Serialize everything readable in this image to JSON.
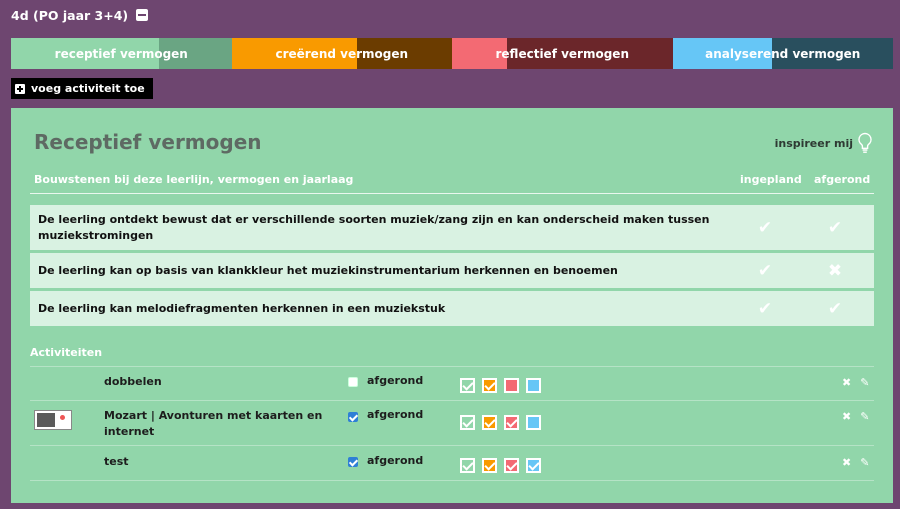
{
  "header": {
    "title": "4d (PO jaar 3+4)"
  },
  "abilities": [
    {
      "label": "receptief vermogen",
      "color": "#91d6aa",
      "rest_color": "#6aa583",
      "progress": 0.67
    },
    {
      "label": "creërend vermogen",
      "color": "#f99a00",
      "rest_color": "#6b3c00",
      "progress": 0.57
    },
    {
      "label": "reflectief vermogen",
      "color": "#f36a73",
      "rest_color": "#6b262a",
      "progress": 0.25
    },
    {
      "label": "analyserend vermogen",
      "color": "#66c6f6",
      "rest_color": "#294f5e",
      "progress": 0.45
    }
  ],
  "toolbar": {
    "add_activity": "voeg activiteit toe"
  },
  "panel": {
    "title": "Receptief vermogen",
    "inspire": "inspireer mij",
    "section_heading": "Bouwstenen bij deze leerlijn, vermogen en jaarlaag",
    "col_planned": "ingepland",
    "col_done": "afgerond",
    "building_blocks": [
      {
        "text": "De leerling ontdekt bewust dat er verschillende soorten muziek/zang zijn en kan onderscheid maken tussen muziekstromingen",
        "planned": "✔",
        "done": "✔"
      },
      {
        "text": "De leerling kan op basis van klankkleur het muziekinstrumentarium herkennen en benoemen",
        "planned": "✔",
        "done": "✖"
      },
      {
        "text": "De leerling kan melodiefragmenten herkennen in een muziekstuk",
        "planned": "✔",
        "done": "✔"
      }
    ],
    "activities_heading": "Activiteiten",
    "activities": [
      {
        "name": "dobbelen",
        "status": "afgerond",
        "checked": false,
        "has_thumb": false,
        "ability_marks": [
          true,
          true,
          false,
          false
        ]
      },
      {
        "name": "Mozart | Avonturen met kaarten en internet",
        "status": "afgerond",
        "checked": true,
        "has_thumb": true,
        "ability_marks": [
          true,
          true,
          true,
          false
        ]
      },
      {
        "name": "test",
        "status": "afgerond",
        "checked": true,
        "has_thumb": false,
        "ability_marks": [
          true,
          true,
          true,
          true
        ]
      }
    ],
    "row_icons": {
      "delete": "✖",
      "edit": "✎"
    }
  }
}
